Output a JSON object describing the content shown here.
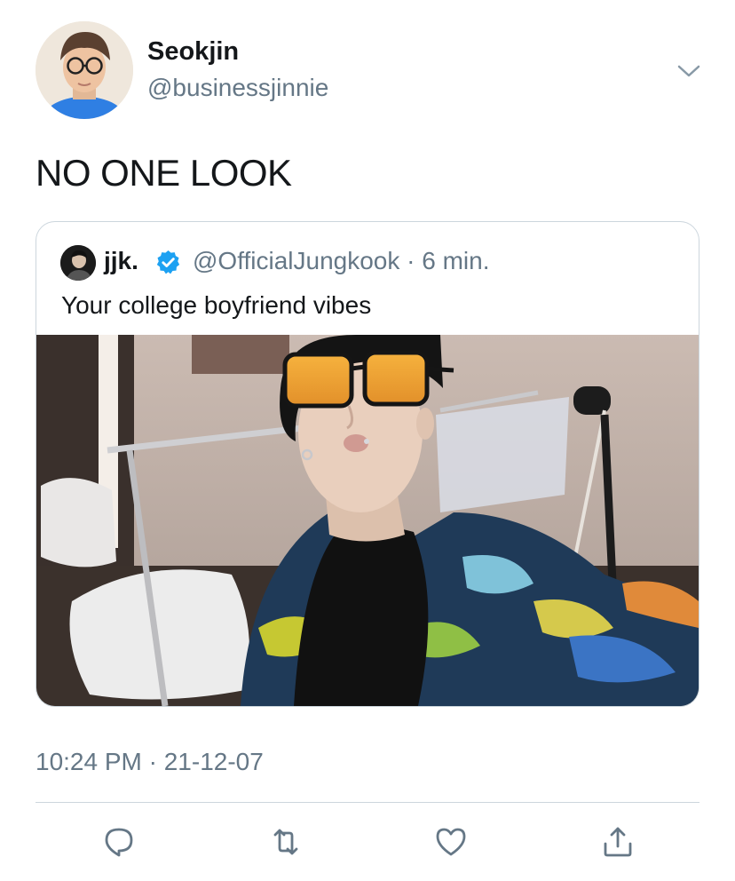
{
  "author": {
    "display_name": "Seokjin",
    "handle": "@businessjinnie",
    "avatar": "profile-photo"
  },
  "menu": {
    "icon": "chevron-down-icon"
  },
  "tweet": {
    "text": "NO ONE LOOK"
  },
  "quote": {
    "name": "jjk.",
    "verified": true,
    "handle": "@OfficialJungkook",
    "time": "6 min.",
    "meta": "@OfficialJungkook · 6 min.",
    "text": "Your college boyfriend vibes",
    "photo": "selfie-photo"
  },
  "timestamp": "10:24 PM · 21-12-07",
  "actions": [
    {
      "name": "reply",
      "icon": "reply-icon"
    },
    {
      "name": "retweet",
      "icon": "retweet-icon"
    },
    {
      "name": "like",
      "icon": "heart-icon"
    },
    {
      "name": "share",
      "icon": "share-icon"
    }
  ],
  "colors": {
    "text": "#14171a",
    "secondary": "#657786",
    "border": "#ccd6dd",
    "verified": "#1da1f2"
  }
}
